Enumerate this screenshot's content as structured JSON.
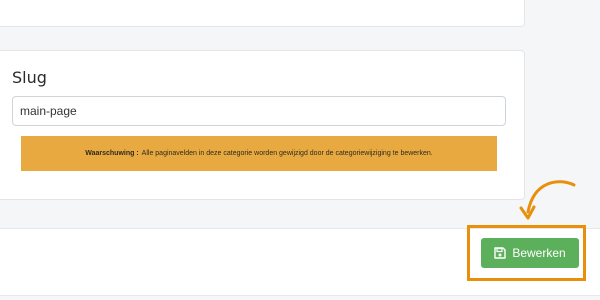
{
  "form": {
    "slug_label": "Slug",
    "slug_value": "main-page"
  },
  "warning": {
    "title": "Waarschuwing :",
    "message": "Alle paginavelden in deze categorie worden gewijzigd door de categoriewijziging te bewerken."
  },
  "actions": {
    "save_label": "Bewerken",
    "save_icon": "floppy-disk-icon"
  },
  "colors": {
    "warning_bg": "#e8aa40",
    "save_button": "#5cb05c",
    "highlight": "#e8900c"
  }
}
